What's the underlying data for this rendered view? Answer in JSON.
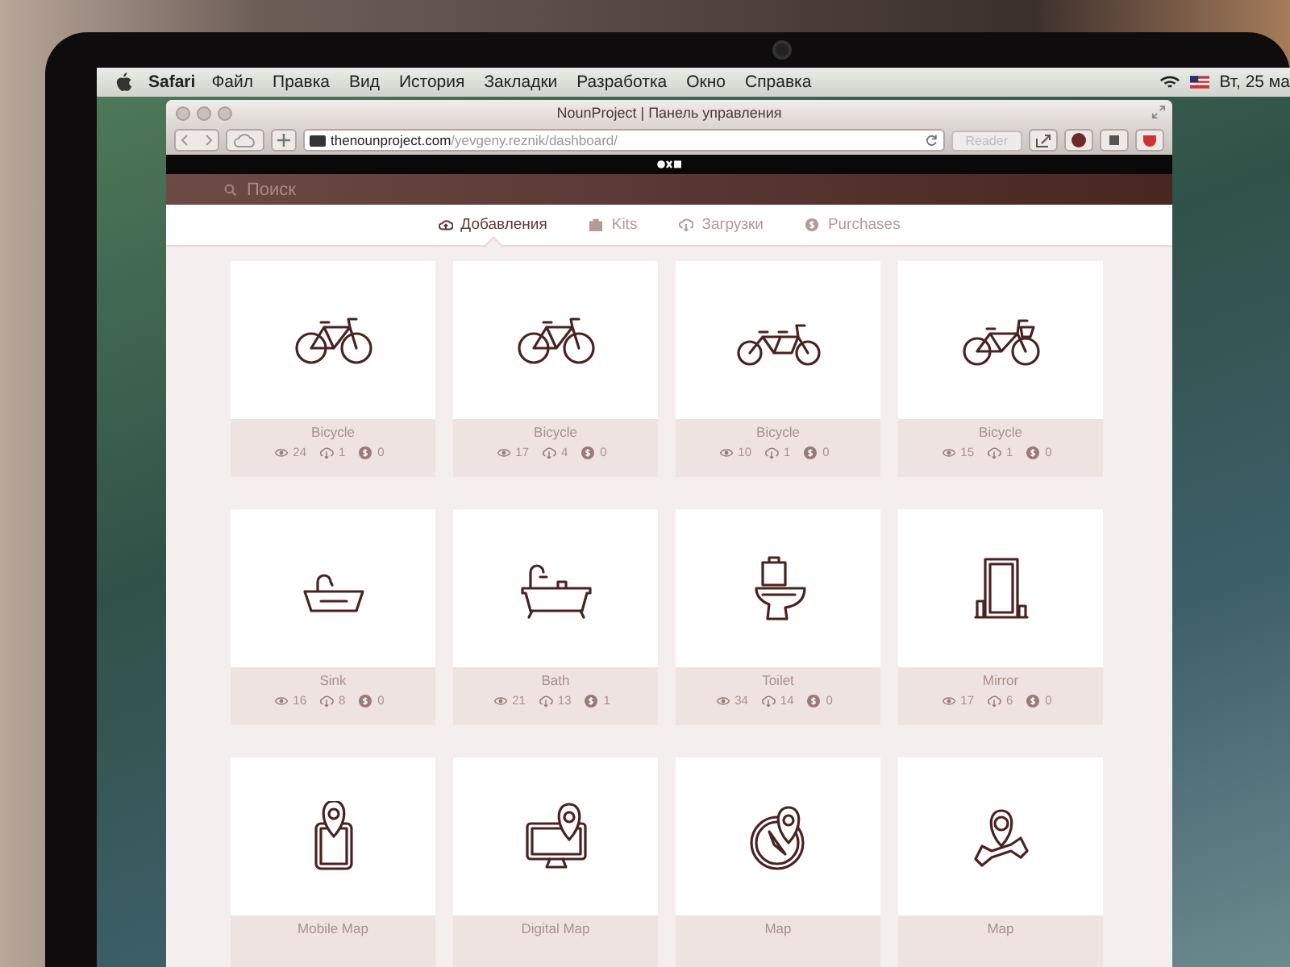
{
  "menu_bar": {
    "app": "Safari",
    "items": [
      "Файл",
      "Правка",
      "Вид",
      "История",
      "Закладки",
      "Разработка",
      "Окно",
      "Справка"
    ],
    "clock": "Вт, 25 ма"
  },
  "window": {
    "title": "NounProject | Панель управления",
    "url_host": "thenounproject.com",
    "url_path": "/yevgeny.reznik/dashboard/",
    "reader": "Reader"
  },
  "search": {
    "placeholder": "Поиск"
  },
  "tabs": [
    {
      "label": "Добавления",
      "selected": true
    },
    {
      "label": "Kits",
      "selected": false
    },
    {
      "label": "Загрузки",
      "selected": false
    },
    {
      "label": "Purchases",
      "selected": false
    }
  ],
  "icons": [
    {
      "kind": "bicycle",
      "name": "Bicycle",
      "views": "24",
      "downloads": "1",
      "purchases": "0"
    },
    {
      "kind": "bicycle",
      "name": "Bicycle",
      "views": "17",
      "downloads": "4",
      "purchases": "0"
    },
    {
      "kind": "tandem",
      "name": "Bicycle",
      "views": "10",
      "downloads": "1",
      "purchases": "0"
    },
    {
      "kind": "basket-bicycle",
      "name": "Bicycle",
      "views": "15",
      "downloads": "1",
      "purchases": "0"
    },
    {
      "kind": "sink",
      "name": "Sink",
      "views": "16",
      "downloads": "8",
      "purchases": "0"
    },
    {
      "kind": "bath",
      "name": "Bath",
      "views": "21",
      "downloads": "13",
      "purchases": "1"
    },
    {
      "kind": "toilet",
      "name": "Toilet",
      "views": "34",
      "downloads": "14",
      "purchases": "0"
    },
    {
      "kind": "mirror",
      "name": "Mirror",
      "views": "17",
      "downloads": "6",
      "purchases": "0"
    },
    {
      "kind": "mobile-map",
      "name": "Mobile Map"
    },
    {
      "kind": "digital-map",
      "name": "Digital Map"
    },
    {
      "kind": "compass-map",
      "name": "Map"
    },
    {
      "kind": "folded-map",
      "name": "Map"
    }
  ]
}
